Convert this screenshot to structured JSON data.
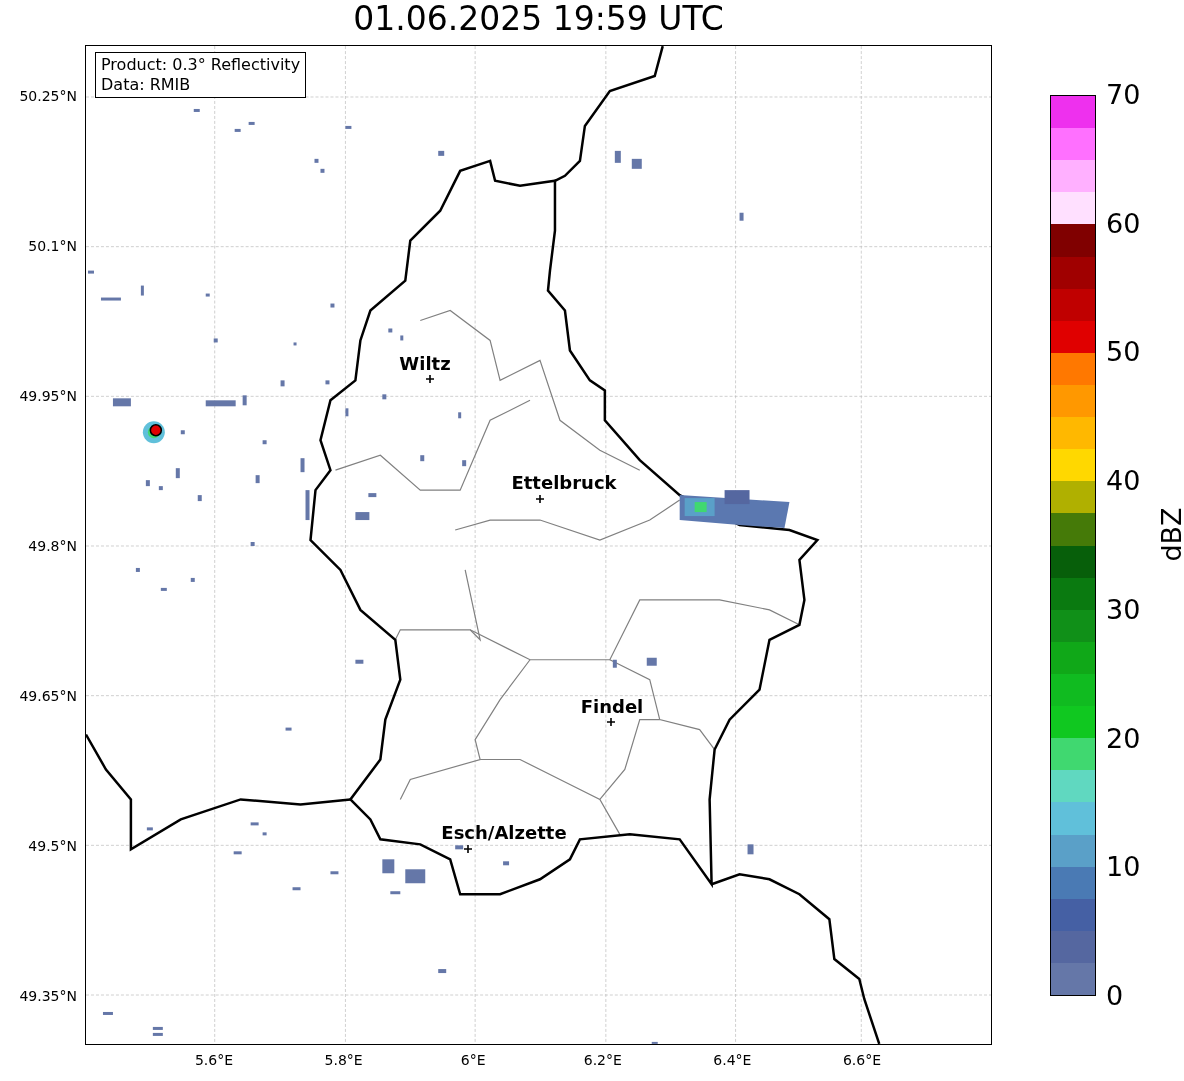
{
  "title": "01.06.2025 19:59 UTC",
  "info_box": {
    "product": "Product: 0.3° Reflectivity",
    "data": "Data: RMIB"
  },
  "lat_ticks": [
    "50.25°N",
    "50.1°N",
    "49.95°N",
    "49.8°N",
    "49.65°N",
    "49.5°N",
    "49.35°N"
  ],
  "lon_ticks": [
    "5.6°E",
    "5.8°E",
    "6°E",
    "6.2°E",
    "6.4°E",
    "6.6°E"
  ],
  "cities": [
    {
      "name": "Wiltz"
    },
    {
      "name": "Ettelbruck"
    },
    {
      "name": "Findel"
    },
    {
      "name": "Esch/Alzette"
    }
  ],
  "colorbar": {
    "label": "dBZ",
    "ticks": [
      "70",
      "60",
      "50",
      "40",
      "30",
      "20",
      "10",
      "0"
    ],
    "bands": [
      {
        "color": "#ee30ee"
      },
      {
        "color": "#ff70ff"
      },
      {
        "color": "#ffb0ff"
      },
      {
        "color": "#ffe0ff"
      },
      {
        "color": "#800000"
      },
      {
        "color": "#a00000"
      },
      {
        "color": "#c00000"
      },
      {
        "color": "#e00000"
      },
      {
        "color": "#ff7800"
      },
      {
        "color": "#ff9800"
      },
      {
        "color": "#ffb800"
      },
      {
        "color": "#ffd800"
      },
      {
        "color": "#b0b000"
      },
      {
        "color": "#457a08"
      },
      {
        "color": "#075f0a"
      },
      {
        "color": "#0a7a10"
      },
      {
        "color": "#109018"
      },
      {
        "color": "#10a818"
      },
      {
        "color": "#10bb20"
      },
      {
        "color": "#10c820"
      },
      {
        "color": "#40d870"
      },
      {
        "color": "#60d8c0"
      },
      {
        "color": "#60c0da"
      },
      {
        "color": "#5aa0c8"
      },
      {
        "color": "#4a7ab4"
      },
      {
        "color": "#4560a4"
      },
      {
        "color": "#5567a0"
      },
      {
        "color": "#6577a8"
      }
    ]
  }
}
